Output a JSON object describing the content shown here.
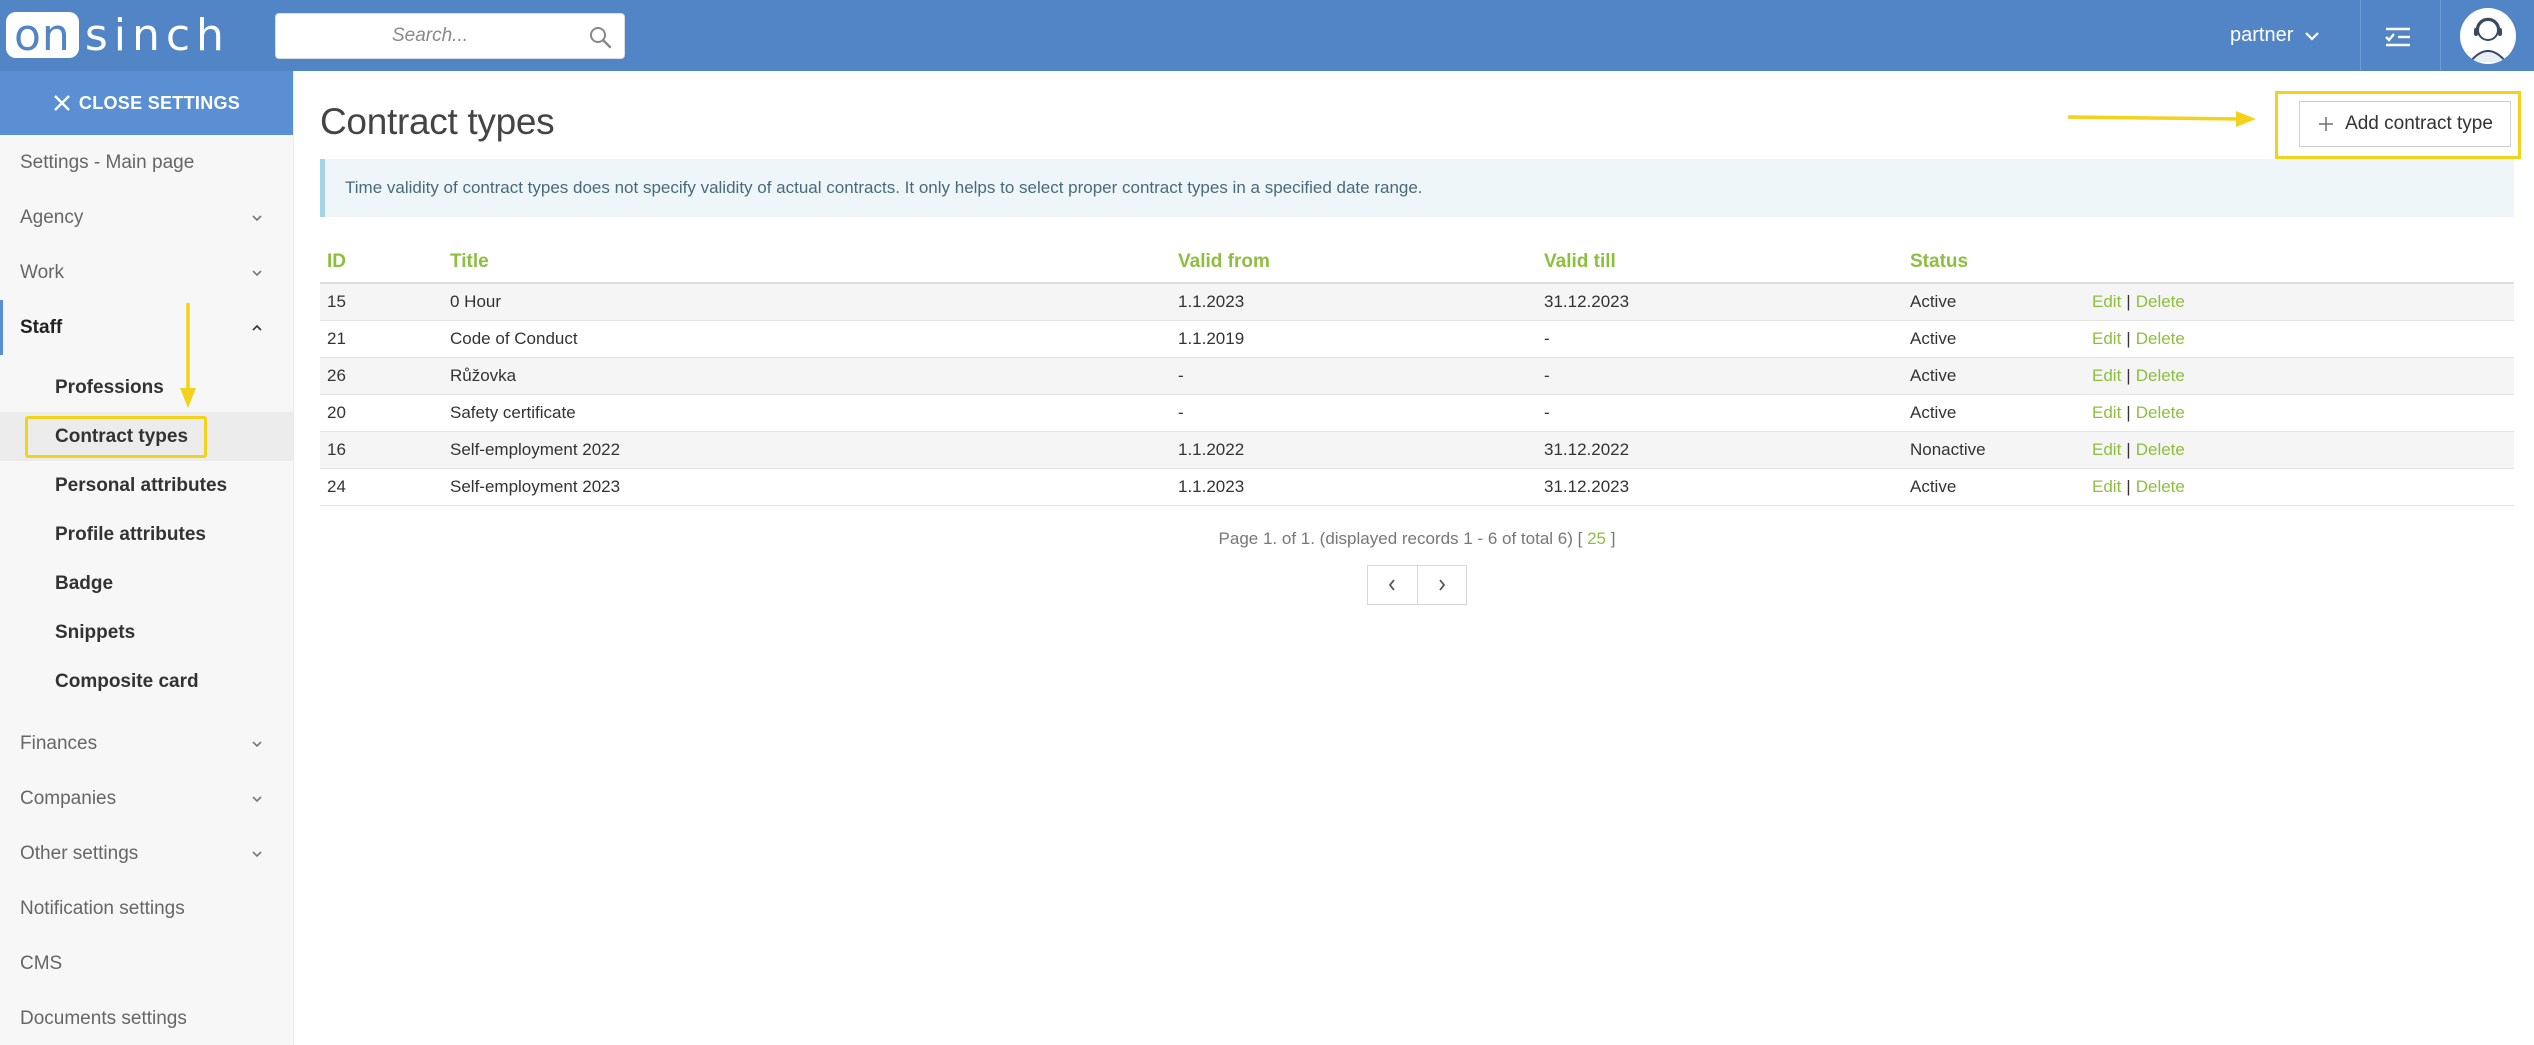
{
  "app": {
    "logo_left": "on",
    "logo_right": "sinch"
  },
  "search": {
    "placeholder": "Search..."
  },
  "header": {
    "user_label": "partner"
  },
  "sidebar": {
    "close_label": "CLOSE SETTINGS",
    "items_top": [
      {
        "label": "Settings - Main page",
        "has_chevron": false
      },
      {
        "label": "Agency",
        "has_chevron": true
      },
      {
        "label": "Work",
        "has_chevron": true
      }
    ],
    "expanded": {
      "label": "Staff"
    },
    "sub_items": [
      "Professions",
      "Contract types",
      "Personal attributes",
      "Profile attributes",
      "Badge",
      "Snippets",
      "Composite card"
    ],
    "current_sub": "Contract types",
    "items_bottom": [
      {
        "label": "Finances",
        "has_chevron": true
      },
      {
        "label": "Companies",
        "has_chevron": true
      },
      {
        "label": "Other settings",
        "has_chevron": true
      },
      {
        "label": "Notification settings",
        "has_chevron": false
      },
      {
        "label": "CMS",
        "has_chevron": false
      },
      {
        "label": "Documents settings",
        "has_chevron": false
      }
    ]
  },
  "main": {
    "title": "Contract types",
    "add_button": "Add contract type",
    "info": "Time validity of contract types does not specify validity of actual contracts. It only helps to select proper contract types in a specified date range.",
    "columns": [
      "ID",
      "Title",
      "Valid from",
      "Valid till",
      "Status"
    ],
    "rows": [
      {
        "id": "15",
        "title": "0 Hour",
        "from": "1.1.2023",
        "till": "31.12.2023",
        "status": "Active"
      },
      {
        "id": "21",
        "title": "Code of Conduct",
        "from": "1.1.2019",
        "till": "-",
        "status": "Active"
      },
      {
        "id": "26",
        "title": "Růžovka",
        "from": "-",
        "till": "-",
        "status": "Active"
      },
      {
        "id": "20",
        "title": "Safety certificate",
        "from": "-",
        "till": "-",
        "status": "Active"
      },
      {
        "id": "16",
        "title": "Self-employment 2022",
        "from": "1.1.2022",
        "till": "31.12.2022",
        "status": "Nonactive"
      },
      {
        "id": "24",
        "title": "Self-employment 2023",
        "from": "1.1.2023",
        "till": "31.12.2023",
        "status": "Active"
      }
    ],
    "row_actions": {
      "edit": "Edit",
      "separator": "|",
      "delete": "Delete"
    },
    "pager": {
      "text_before": "Page 1. of 1. (displayed records 1 - 6 of total 6) [",
      "page_size": "25",
      "text_after": "]"
    }
  },
  "colors": {
    "topbar": "#5285c6",
    "accent_green": "#8dbf3f",
    "highlight_yellow": "#f3d21c"
  }
}
